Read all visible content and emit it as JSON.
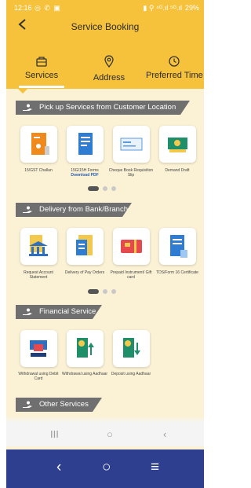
{
  "status_bar": {
    "time": "12:16",
    "icons": "◎ ✆ ▣",
    "right_icons": "▮ ⚲ ⁴ᴳ.ıl ⁵ᴳ.ıl",
    "battery": "29%"
  },
  "header": {
    "title": "Service Booking",
    "back_icon": "arrow-left-icon"
  },
  "tabs": [
    {
      "label": "Services",
      "icon": "bag-icon",
      "active": true
    },
    {
      "label": "Address",
      "icon": "location-pin-icon"
    },
    {
      "label": "Preferred Time",
      "icon": "clock-icon"
    }
  ],
  "sections": [
    {
      "title": "Pick up Services from Customer Location",
      "items": [
        {
          "caption": "15/GST Challan"
        },
        {
          "caption": "15G/15H Forms",
          "link": "Download PDF"
        },
        {
          "caption": "Cheque Book Requisition Slip"
        },
        {
          "caption": "Demand Draft"
        }
      ]
    },
    {
      "title": "Delivery from Bank/Branch",
      "items": [
        {
          "caption": "Request Account Statement"
        },
        {
          "caption": "Delivery of Pay Orders"
        },
        {
          "caption": "Prepaid Instrument/ Gift card"
        },
        {
          "caption": "TDS/Form 16 Certificate"
        }
      ]
    },
    {
      "title": "Financial Service",
      "items": [
        {
          "caption": "Withdrawal using Debit Card"
        },
        {
          "caption": "Withdrawal using Aadhaar"
        },
        {
          "caption": "Deposit using Aadhaar"
        }
      ]
    },
    {
      "title": "Other Services",
      "items": []
    }
  ],
  "system_nav": {
    "recents": "III",
    "home": "○",
    "back": "‹"
  },
  "bottom_nav": {
    "back": "‹",
    "home": "○",
    "menu": "≡"
  },
  "colors": {
    "accent": "#f6c23c",
    "background": "#fbf2d6",
    "ribbon": "#6f6f6f",
    "bottom_bar": "#2e3f8f"
  }
}
